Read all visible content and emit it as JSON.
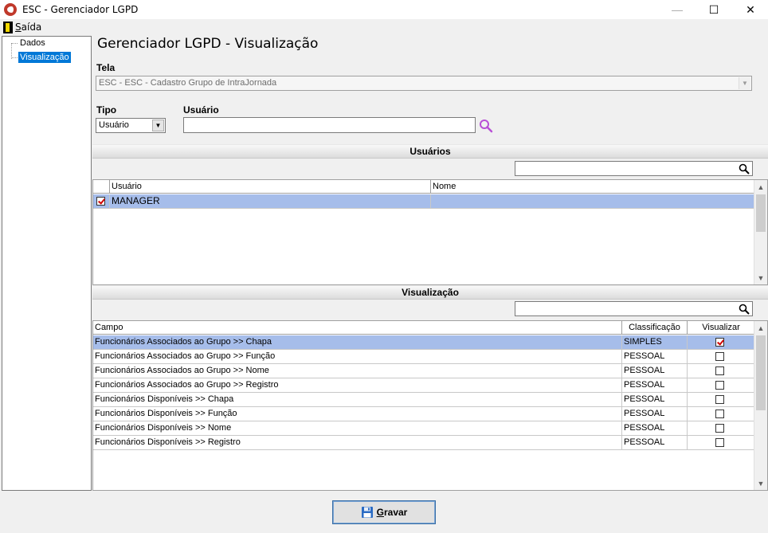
{
  "window": {
    "title": "ESC - Gerenciador LGPD",
    "minimize": "—",
    "maximize": "☐",
    "close": "✕"
  },
  "menu": {
    "saida_underlined": "S",
    "saida_rest": "aída",
    "icon": "door-exit-icon"
  },
  "tree": {
    "items": [
      {
        "label": "Dados"
      },
      {
        "label": "Visualização",
        "selected": true
      }
    ]
  },
  "page": {
    "title": "Gerenciador LGPD - Visualização"
  },
  "tela": {
    "label": "Tela",
    "value": "ESC - ESC - Cadastro Grupo de IntraJornada"
  },
  "tipo": {
    "label": "Tipo",
    "value": "Usuário"
  },
  "usuario": {
    "label": "Usuário",
    "value": "",
    "lookup_icon": "search-icon"
  },
  "usuarios_section": {
    "title": "Usuários",
    "search_value": "",
    "columns": [
      "",
      "Usuário",
      "Nome"
    ],
    "rows": [
      {
        "checked": true,
        "usuario": "MANAGER",
        "nome": "",
        "selected": true
      }
    ]
  },
  "visualizacao_section": {
    "title": "Visualização",
    "search_value": "",
    "columns": [
      "Campo",
      "Classificação",
      "Visualizar"
    ],
    "rows": [
      {
        "campo": "Funcionários Associados ao Grupo >> Chapa",
        "classificacao": "SIMPLES",
        "visualizar": true,
        "selected": true
      },
      {
        "campo": "Funcionários Associados ao Grupo >> Função",
        "classificacao": "PESSOAL",
        "visualizar": false
      },
      {
        "campo": "Funcionários Associados ao Grupo >> Nome",
        "classificacao": "PESSOAL",
        "visualizar": false
      },
      {
        "campo": "Funcionários Associados ao Grupo >> Registro",
        "classificacao": "PESSOAL",
        "visualizar": false
      },
      {
        "campo": "Funcionários Disponíveis >> Chapa",
        "classificacao": "PESSOAL",
        "visualizar": false
      },
      {
        "campo": "Funcionários Disponíveis >> Função",
        "classificacao": "PESSOAL",
        "visualizar": false
      },
      {
        "campo": "Funcionários Disponíveis >> Nome",
        "classificacao": "PESSOAL",
        "visualizar": false
      },
      {
        "campo": "Funcionários Disponíveis >> Registro",
        "classificacao": "PESSOAL",
        "visualizar": false
      }
    ]
  },
  "footer": {
    "save_underlined": "G",
    "save_rest": "ravar",
    "save_icon": "floppy-disk-icon"
  },
  "colors": {
    "selected_row": "#a6bdea",
    "tree_selected": "#0078d7",
    "check_mark": "#d00000",
    "lookup_icon": "#b84fd6"
  }
}
